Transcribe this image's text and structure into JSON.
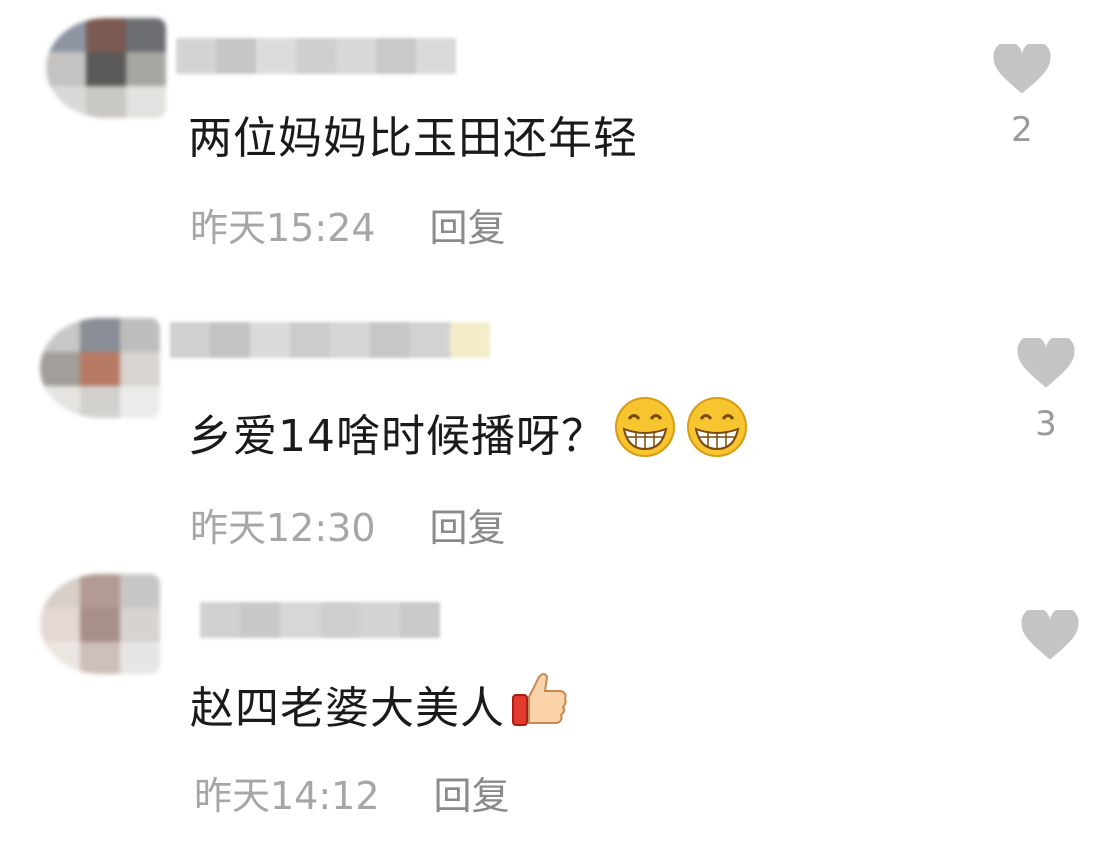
{
  "comments": [
    {
      "text": "两位妈妈比玉田还年轻",
      "time": "昨天15:24",
      "reply_label": "回复",
      "like_count": "2",
      "avatar_colors": [
        "#8f95a3",
        "#7a5a52",
        "#6d6f73",
        "#c4c3c1",
        "#5c5a58",
        "#a7a6a3",
        "#d9d8d6",
        "#c9c7c4",
        "#e2e2e0"
      ],
      "username_colors": [
        "#d4d4d4",
        "#c6c6c6",
        "#dcdcdc",
        "#cfcfcf",
        "#d8d8d8",
        "#c9c9c9",
        "#dadada"
      ],
      "emojis": []
    },
    {
      "text": "乡爱14啥时候播呀？",
      "time": "昨天12:30",
      "reply_label": "回复",
      "like_count": "3",
      "avatar_colors": [
        "#c8c7c5",
        "#8a8e96",
        "#bfbdbb",
        "#a29e98",
        "#b77a65",
        "#d8d4cf",
        "#e6e4e1",
        "#d3d1ce",
        "#ecebe9"
      ],
      "username_colors": [
        "#d0d0d0",
        "#c3c3c3",
        "#dadada",
        "#cccccc",
        "#d6d6d6",
        "#c7c7c7",
        "#d2d2d2",
        "#f2ecc9"
      ],
      "emojis": [
        "grin-emoji",
        "grin-emoji"
      ]
    },
    {
      "text": "赵四老婆大美人",
      "time": "昨天14:12",
      "reply_label": "回复",
      "like_count": "",
      "avatar_colors": [
        "#d9cfc9",
        "#b39a94",
        "#c8c6c4",
        "#e4d9d2",
        "#a88f8a",
        "#d6d3d0",
        "#ece6e1",
        "#cdbfb9",
        "#e8e6e4"
      ],
      "username_colors": [
        "#d1d1d1",
        "#c8c8c8",
        "#d7d7d7",
        "#cecece",
        "#d3d3d3",
        "#cacaca"
      ],
      "emojis": [
        "thumbs-up-emoji"
      ]
    }
  ],
  "colors": {
    "heart": "#c4c4c4",
    "text": "#1a1a1a",
    "meta": "#a6a6a6"
  }
}
